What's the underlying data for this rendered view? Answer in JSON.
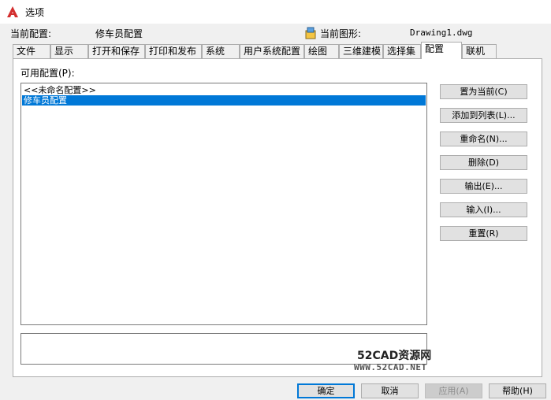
{
  "window": {
    "title": "选项",
    "icon": "autocad-logo-icon",
    "accent_color": "#d32f2f"
  },
  "info": {
    "profile_label": "当前配置:",
    "profile_value": "修车员配置",
    "drawing_label": "当前图形:",
    "drawing_value": "Drawing1.dwg",
    "drawing_icon": "drawing-file-icon"
  },
  "tabs": [
    {
      "label": "文件"
    },
    {
      "label": "显示"
    },
    {
      "label": "打开和保存"
    },
    {
      "label": "打印和发布"
    },
    {
      "label": "系统"
    },
    {
      "label": "用户系统配置"
    },
    {
      "label": "绘图"
    },
    {
      "label": "三维建模"
    },
    {
      "label": "选择集"
    },
    {
      "label": "配置"
    },
    {
      "label": "联机"
    }
  ],
  "active_tab": "配置",
  "profiles": {
    "label": "可用配置(P):",
    "items": [
      {
        "label": "<<未命名配置>>",
        "selected": false
      },
      {
        "label": "修车员配置",
        "selected": true
      }
    ],
    "selection_color": "#0078d7"
  },
  "side_buttons": [
    {
      "label": "置为当前(C)"
    },
    {
      "label": "添加到列表(L)..."
    },
    {
      "label": "重命名(N)..."
    },
    {
      "label": "删除(D)"
    },
    {
      "label": "输出(E)..."
    },
    {
      "label": "输入(I)..."
    },
    {
      "label": "重置(R)"
    }
  ],
  "watermark": {
    "line1": "52CAD资源网",
    "line2": "WWW.52CAD.NET"
  },
  "bottom_buttons": [
    {
      "label": "确定",
      "state": "default"
    },
    {
      "label": "取消",
      "state": "normal"
    },
    {
      "label": "应用(A)",
      "state": "disabled"
    },
    {
      "label": "帮助(H)",
      "state": "normal"
    }
  ]
}
